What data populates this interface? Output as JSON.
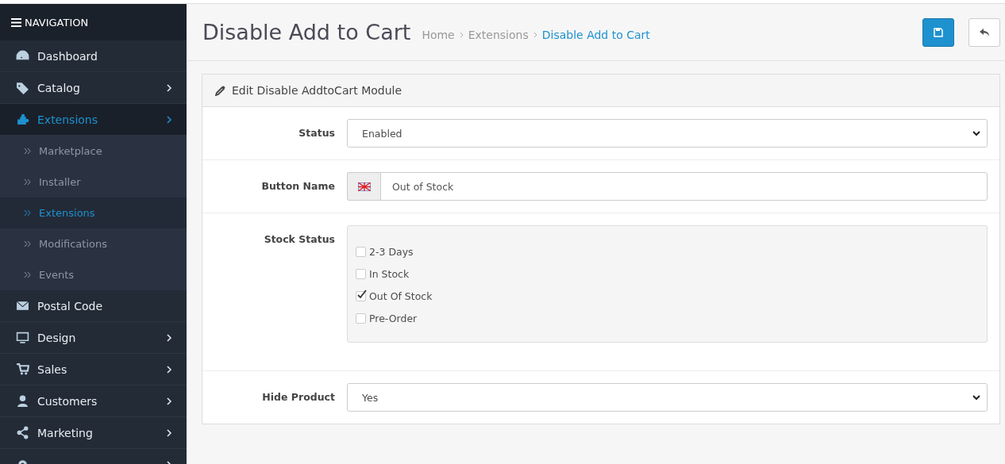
{
  "navigation": {
    "title": "NAVIGATION"
  },
  "sidebar": {
    "items": [
      {
        "label": "Dashboard",
        "expandable": false,
        "selected": false
      },
      {
        "label": "Catalog",
        "expandable": true,
        "selected": false
      },
      {
        "label": "Extensions",
        "expandable": true,
        "selected": true,
        "expanded": true,
        "children": [
          {
            "label": "Marketplace",
            "selected": false
          },
          {
            "label": "Installer",
            "selected": false
          },
          {
            "label": "Extensions",
            "selected": true
          },
          {
            "label": "Modifications",
            "selected": false
          },
          {
            "label": "Events",
            "selected": false
          }
        ]
      },
      {
        "label": "Postal Code",
        "expandable": false,
        "selected": false
      },
      {
        "label": "Design",
        "expandable": true,
        "selected": false
      },
      {
        "label": "Sales",
        "expandable": true,
        "selected": false
      },
      {
        "label": "Customers",
        "expandable": true,
        "selected": false
      },
      {
        "label": "Marketing",
        "expandable": true,
        "selected": false
      },
      {
        "expandable": true,
        "selected": false
      }
    ]
  },
  "header": {
    "title": "Disable Add to Cart",
    "breadcrumb": [
      "Home",
      "Extensions",
      "Disable Add to Cart"
    ]
  },
  "panel": {
    "title": "Edit Disable AddtoCart Module",
    "fields": [
      {
        "kind": "select",
        "label": "Status",
        "value": "Enabled"
      },
      {
        "kind": "text",
        "label": "Button Name",
        "value": "Out of Stock"
      },
      {
        "kind": "checklist",
        "label": "Stock Status",
        "options": [
          {
            "label": "2-3 Days",
            "checked": false
          },
          {
            "label": "In Stock",
            "checked": false
          },
          {
            "label": "Out Of Stock",
            "checked": true
          },
          {
            "label": "Pre-Order",
            "checked": false
          }
        ]
      },
      {
        "kind": "select",
        "label": "Hide Product",
        "value": "Yes"
      }
    ]
  }
}
